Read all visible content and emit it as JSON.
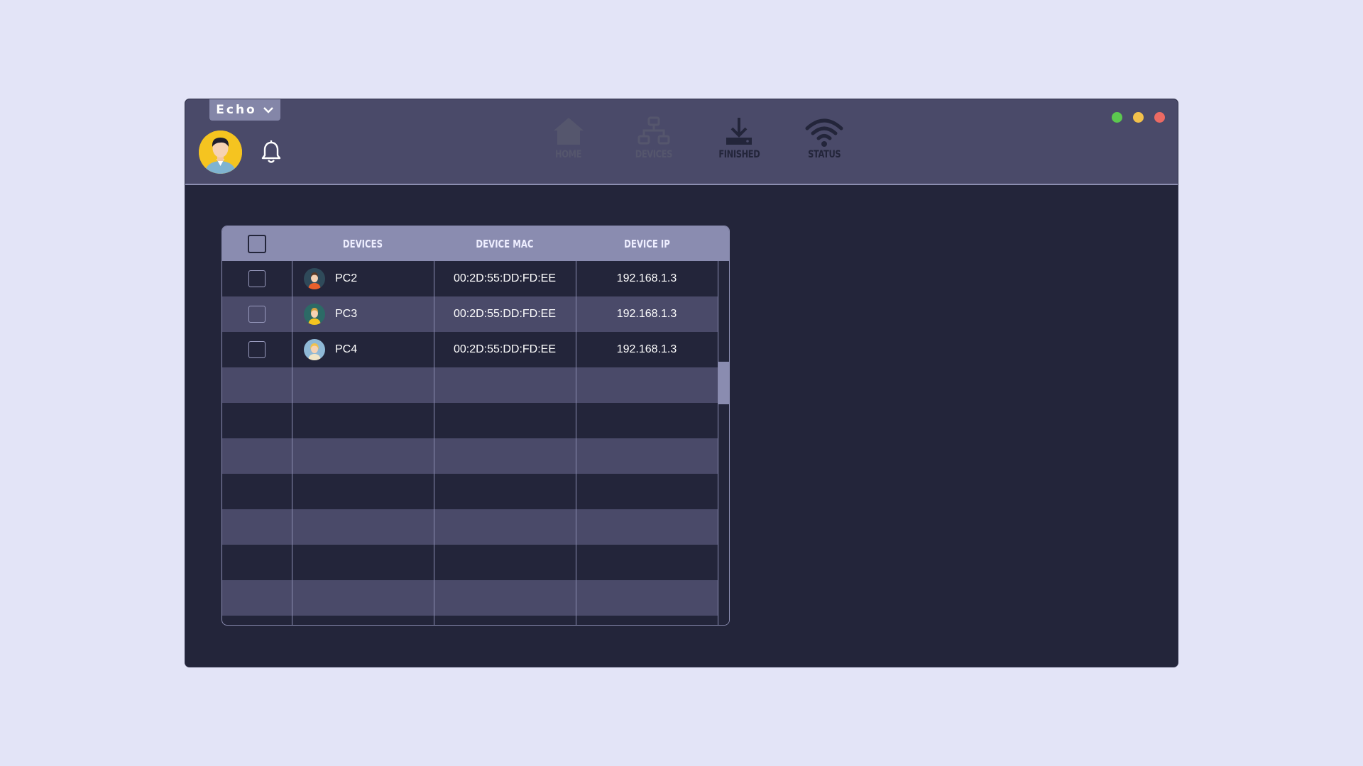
{
  "header": {
    "profile_name": "Echo",
    "nav": [
      {
        "label": "HOME",
        "icon": "home-icon",
        "state": "disabled"
      },
      {
        "label": "DEVICES",
        "icon": "network-icon",
        "state": "disabled"
      },
      {
        "label": "FINISHED",
        "icon": "download-icon",
        "state": "enabled"
      },
      {
        "label": "STATUS",
        "icon": "wifi-icon",
        "state": "enabled"
      }
    ],
    "window_controls": [
      {
        "name": "maximize",
        "color": "#5cc84f"
      },
      {
        "name": "minimize",
        "color": "#f2c14b"
      },
      {
        "name": "close",
        "color": "#ec6a63"
      }
    ]
  },
  "table": {
    "columns": [
      "DEVICES",
      "DEVICE MAC",
      "DEVICE IP"
    ],
    "rows": [
      {
        "device": "PC2",
        "mac": "00:2D:55:DD:FD:EE",
        "ip": "192.168.1.3",
        "avatar_bg": "#2f4a5a"
      },
      {
        "device": "PC3",
        "mac": "00:2D:55:DD:FD:EE",
        "ip": "192.168.1.3",
        "avatar_bg": "#2c6a66"
      },
      {
        "device": "PC4",
        "mac": "00:2D:55:DD:FD:EE",
        "ip": "192.168.1.3",
        "avatar_bg": "#8fb9d6"
      }
    ]
  },
  "colors": {
    "background": "#e3e4f7",
    "window": "#23253a",
    "titlebar": "#4a4a69",
    "table_header": "#8a8cb0",
    "row_alt": "#4a4a69"
  }
}
